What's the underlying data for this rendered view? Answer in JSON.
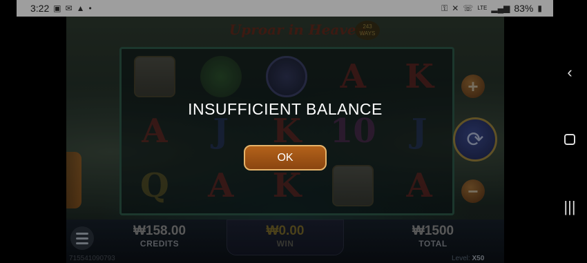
{
  "status_bar": {
    "time": "3:22",
    "battery_text": "83%",
    "network": "LTE",
    "left_icons": [
      "gallery-icon",
      "message-icon",
      "warning-icon",
      "dot-icon"
    ],
    "right_icons": [
      "key-icon",
      "mute-icon",
      "wifi-calling-icon",
      "lte-icon",
      "signal-icon",
      "battery-icon"
    ]
  },
  "game": {
    "title": "Uproar in Heaven",
    "ways_badge": "243 WAYS",
    "reels": [
      [
        "gate",
        "helmet",
        "palm",
        "A",
        "K"
      ],
      [
        "A",
        "J",
        "K",
        "10",
        "J"
      ],
      [
        "Q",
        "A",
        "K",
        "gate",
        "A"
      ]
    ],
    "meters": {
      "credits_value": "₩158.00",
      "credits_label": "CREDITS",
      "win_value": "₩0.00",
      "win_label": "WIN",
      "total_value": "₩1500",
      "total_label": "TOTAL"
    },
    "account_id": "715541090793",
    "level_label": "Level:",
    "level_value": "X50",
    "plus_symbol": "+",
    "minus_symbol": "−",
    "spin_symbol": "⟳"
  },
  "modal": {
    "message": "INSUFFICIENT BALANCE",
    "ok_label": "OK"
  },
  "nav": {
    "back": "‹",
    "recents": "|||"
  },
  "colors": {
    "ok_button": "#8a4510",
    "ok_border": "#e6b36a",
    "status_bar_bg": "#ffffff"
  }
}
